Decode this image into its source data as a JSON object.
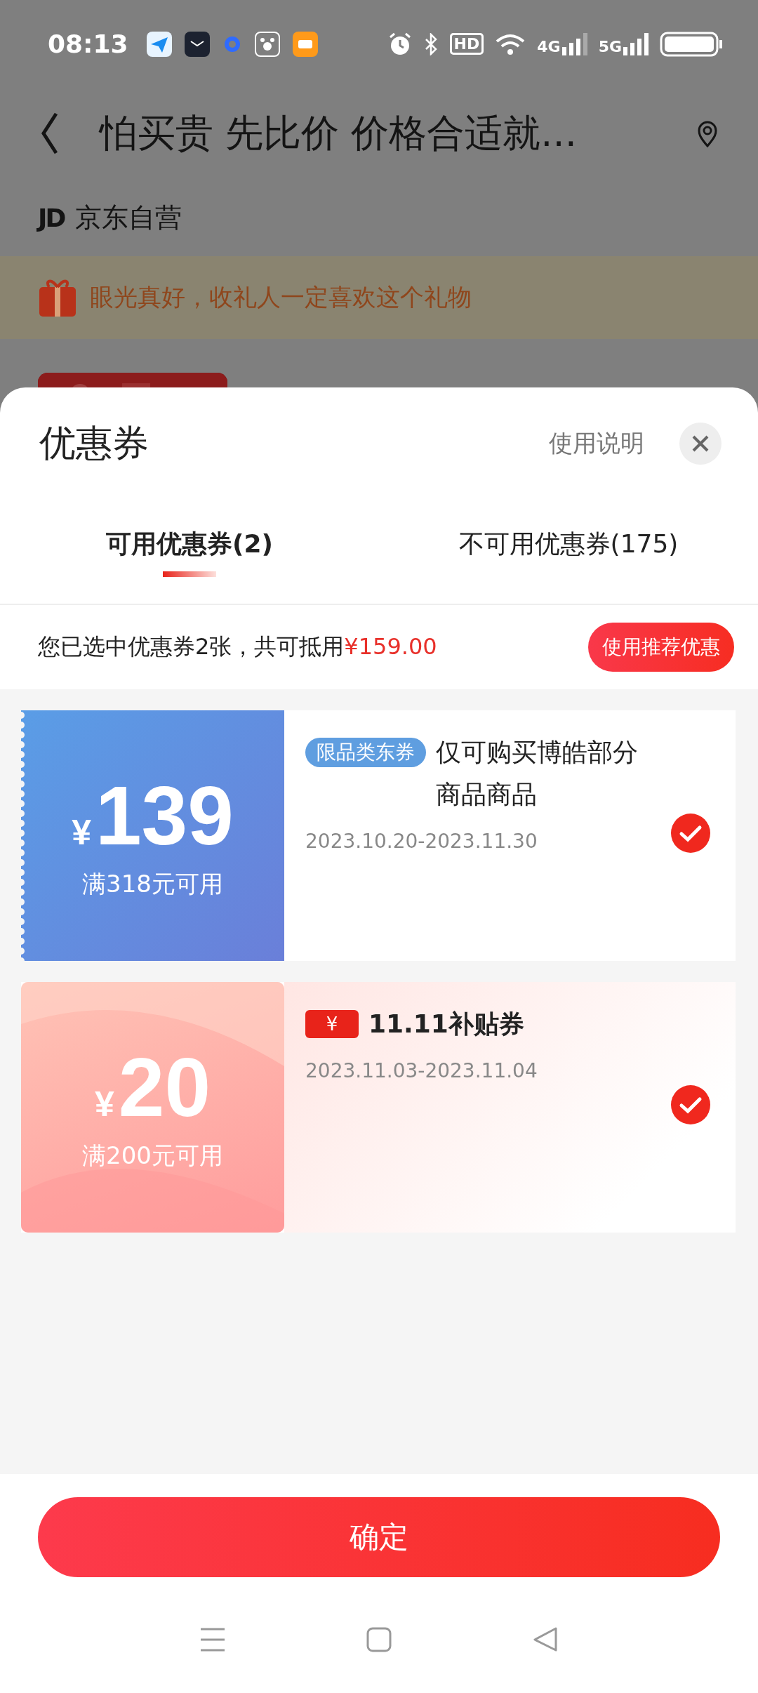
{
  "status_bar": {
    "time": "08:13",
    "network_labels": [
      "HD",
      "4G",
      "5G"
    ]
  },
  "page": {
    "title": "怕买贵 先比价 价格合适就...",
    "store_logo": "JD",
    "store": "京东自营",
    "gift_banner": "眼光真好，收礼人一定喜欢这个礼物"
  },
  "sheet": {
    "title": "优惠券",
    "help_link": "使用说明",
    "tabs": [
      {
        "label": "可用优惠券(2)",
        "selected": true
      },
      {
        "label": "不可用优惠券(175)",
        "selected": false
      }
    ],
    "summary": {
      "text": "您已选中优惠券2张，共可抵用",
      "amount": "¥159.00",
      "button": "使用推荐优惠"
    },
    "coupons": [
      {
        "kind": "category",
        "currency": "¥",
        "amount": "139",
        "condition": "满318元可用",
        "tag": "限品类东券",
        "title": "仅可购买博皓部分商品商品",
        "dates": "2023.10.20-2023.11.30",
        "selected": true
      },
      {
        "kind": "subsidy",
        "currency": "¥",
        "amount": "20",
        "condition": "满200元可用",
        "badge": "¥",
        "title": "11.11补贴券",
        "dates": "2023.11.03-2023.11.04",
        "selected": true
      }
    ],
    "confirm": "确定"
  }
}
